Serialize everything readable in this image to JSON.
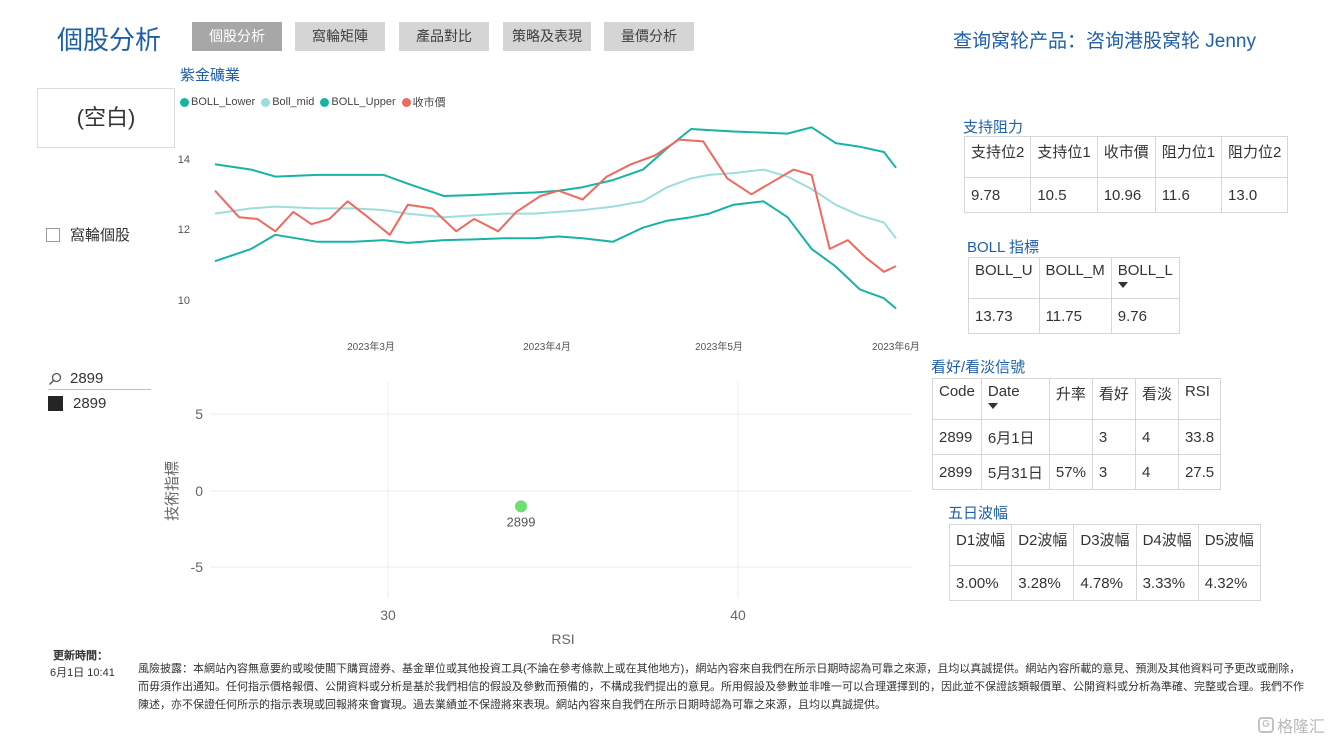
{
  "page_title": "個股分析",
  "tabs": [
    {
      "label": "個股分析",
      "active": true
    },
    {
      "label": "窩輪矩陣",
      "active": false
    },
    {
      "label": "產品對比",
      "active": false
    },
    {
      "label": "策略及表現",
      "active": false
    },
    {
      "label": "量價分析",
      "active": false
    }
  ],
  "query_title": "查询窝轮产品：咨询港股窝轮 Jenny",
  "blank_card": "(空白)",
  "warrant_checkbox_label": "窩輪個股",
  "search": {
    "value": "2899",
    "icon": "search-icon"
  },
  "slicer_item": "2899",
  "boll_chart": {
    "title": "紫金礦業",
    "legend": [
      {
        "name": "BOLL_Lower",
        "color": "#17b3a3"
      },
      {
        "name": "Boll_mid",
        "color": "#9cdedd"
      },
      {
        "name": "BOLL_Upper",
        "color": "#17b3a3"
      },
      {
        "name": "收市價",
        "color": "#ee6a5f"
      }
    ],
    "y_ticks": [
      "14",
      "12",
      "10"
    ],
    "x_ticks": [
      "2023年3月",
      "2023年4月",
      "2023年5月",
      "2023年6月"
    ]
  },
  "scatter_chart": {
    "ylabel": "技術指標",
    "xlabel": "RSI",
    "y_ticks": [
      "5",
      "0",
      "-5"
    ],
    "x_ticks": [
      "30",
      "40"
    ],
    "point_label": "2899",
    "point_color": "#6ee06e"
  },
  "chart_data": [
    {
      "type": "line",
      "title": "紫金礦業",
      "x_range": [
        "2023-02-08",
        "2023-06-01"
      ],
      "ylim": [
        9.5,
        15
      ],
      "x_ticks": [
        "2023年3月",
        "2023年4月",
        "2023年5月",
        "2023年6月"
      ],
      "series": [
        {
          "name": "BOLL_Upper",
          "color": "#17b3a3",
          "x": [
            "2023-02-08",
            "2023-02-14",
            "2023-02-18",
            "2023-02-25",
            "2023-03-03",
            "2023-03-08",
            "2023-03-12",
            "2023-03-18",
            "2023-03-23",
            "2023-03-28",
            "2023-04-02",
            "2023-04-06",
            "2023-04-10",
            "2023-04-15",
            "2023-04-20",
            "2023-04-24",
            "2023-04-28",
            "2023-05-01",
            "2023-05-05",
            "2023-05-10",
            "2023-05-14",
            "2023-05-18",
            "2023-05-22",
            "2023-05-26",
            "2023-05-30",
            "2023-06-01"
          ],
          "values": [
            13.85,
            13.7,
            13.5,
            13.55,
            13.55,
            13.55,
            13.3,
            12.95,
            12.98,
            13.02,
            13.05,
            13.1,
            13.2,
            13.4,
            13.7,
            14.3,
            14.85,
            14.82,
            14.78,
            14.75,
            14.72,
            14.9,
            14.45,
            14.35,
            14.2,
            13.75
          ]
        },
        {
          "name": "Boll_mid",
          "color": "#9cdedd",
          "x": [
            "2023-02-08",
            "2023-02-14",
            "2023-02-18",
            "2023-02-25",
            "2023-03-03",
            "2023-03-08",
            "2023-03-12",
            "2023-03-18",
            "2023-03-23",
            "2023-03-28",
            "2023-04-02",
            "2023-04-06",
            "2023-04-10",
            "2023-04-15",
            "2023-04-20",
            "2023-04-24",
            "2023-04-28",
            "2023-05-01",
            "2023-05-05",
            "2023-05-10",
            "2023-05-14",
            "2023-05-18",
            "2023-05-22",
            "2023-05-26",
            "2023-05-30",
            "2023-06-01"
          ],
          "values": [
            12.45,
            12.6,
            12.65,
            12.6,
            12.6,
            12.55,
            12.45,
            12.35,
            12.4,
            12.45,
            12.45,
            12.5,
            12.55,
            12.65,
            12.8,
            13.2,
            13.45,
            13.55,
            13.6,
            13.7,
            13.5,
            13.15,
            12.7,
            12.4,
            12.2,
            11.75
          ]
        },
        {
          "name": "BOLL_Lower",
          "color": "#17b3a3",
          "x": [
            "2023-02-08",
            "2023-02-14",
            "2023-02-18",
            "2023-02-25",
            "2023-03-03",
            "2023-03-08",
            "2023-03-12",
            "2023-03-18",
            "2023-03-23",
            "2023-03-28",
            "2023-04-02",
            "2023-04-06",
            "2023-04-10",
            "2023-04-15",
            "2023-04-20",
            "2023-04-24",
            "2023-04-28",
            "2023-05-01",
            "2023-05-05",
            "2023-05-10",
            "2023-05-14",
            "2023-05-18",
            "2023-05-22",
            "2023-05-26",
            "2023-05-30",
            "2023-06-01"
          ],
          "values": [
            11.1,
            11.45,
            11.85,
            11.65,
            11.65,
            11.7,
            11.62,
            11.7,
            11.72,
            11.75,
            11.75,
            11.8,
            11.75,
            11.65,
            12.05,
            12.25,
            12.35,
            12.45,
            12.7,
            12.8,
            12.35,
            11.45,
            10.95,
            10.3,
            10.05,
            9.76
          ]
        },
        {
          "name": "收市價",
          "color": "#ee6a5f",
          "x": [
            "2023-02-08",
            "2023-02-12",
            "2023-02-15",
            "2023-02-18",
            "2023-02-21",
            "2023-02-24",
            "2023-02-27",
            "2023-03-02",
            "2023-03-05",
            "2023-03-09",
            "2023-03-12",
            "2023-03-16",
            "2023-03-20",
            "2023-03-23",
            "2023-03-27",
            "2023-03-30",
            "2023-04-03",
            "2023-04-06",
            "2023-04-10",
            "2023-04-14",
            "2023-04-18",
            "2023-04-22",
            "2023-04-26",
            "2023-04-30",
            "2023-05-04",
            "2023-05-08",
            "2023-05-11",
            "2023-05-15",
            "2023-05-18",
            "2023-05-21",
            "2023-05-24",
            "2023-05-27",
            "2023-05-30",
            "2023-06-01"
          ],
          "values": [
            13.1,
            12.35,
            12.3,
            11.95,
            12.5,
            12.15,
            12.3,
            12.8,
            12.4,
            11.85,
            12.7,
            12.6,
            11.95,
            12.3,
            11.95,
            12.5,
            12.95,
            13.1,
            12.85,
            13.5,
            13.85,
            14.1,
            14.55,
            14.5,
            13.45,
            13.0,
            13.3,
            13.7,
            13.55,
            11.45,
            11.7,
            11.2,
            10.8,
            10.96
          ]
        }
      ]
    },
    {
      "type": "scatter",
      "xlabel": "RSI",
      "ylabel": "技術指標",
      "xlim": [
        25.5,
        45
      ],
      "ylim": [
        -7.5,
        7.5
      ],
      "x_ticks": [
        30,
        40
      ],
      "y_ticks": [
        5,
        0,
        -5
      ],
      "points": [
        {
          "label": "2899",
          "x": 33.8,
          "y": -1
        }
      ]
    }
  ],
  "support_resistance": {
    "title": "支持阻力",
    "headers": [
      "支持位2",
      "支持位1",
      "收市價",
      "阻力位1",
      "阻力位2"
    ],
    "rows": [
      [
        "9.78",
        "10.5",
        "10.96",
        "11.6",
        "13.0"
      ]
    ]
  },
  "boll_indicator": {
    "title": "BOLL 指標",
    "headers": [
      "BOLL_U",
      "BOLL_M",
      "BOLL_L"
    ],
    "rows": [
      [
        "13.73",
        "11.75",
        "9.76"
      ]
    ]
  },
  "signals": {
    "title": "看好/看淡信號",
    "headers": [
      "Code",
      "Date",
      "升率",
      "看好",
      "看淡",
      "RSI"
    ],
    "rows": [
      [
        "2899",
        "6月1日",
        "",
        "3",
        "4",
        "33.8"
      ],
      [
        "2899",
        "5月31日",
        "57%",
        "3",
        "4",
        "27.5"
      ]
    ]
  },
  "five_day": {
    "title": "五日波幅",
    "headers": [
      "D1波幅",
      "D2波幅",
      "D3波幅",
      "D4波幅",
      "D5波幅"
    ],
    "rows": [
      [
        "3.00%",
        "3.28%",
        "4.78%",
        "3.33%",
        "4.32%"
      ]
    ]
  },
  "footer": {
    "update_label": "更新時間：",
    "update_time": "6月1日 10:41",
    "disclaimer": "風險披露：本網站內容無意要約或唆使閣下購買證券、基金單位或其他投資工具(不論在參考條款上或在其他地方)，網站內容來自我們在所示日期時認為可靠之來源，且均以真誠提供。網站內容所載的意見、預測及其他資料可予更改或刪除，而毋須作出通知。任何指示價格報價、公開資料或分析是基於我們相信的假設及參數而預備的，不構成我們提出的意見。所用假設及參數並非唯一可以合理選擇到的，因此並不保證該類報價單、公開資料或分析為準確、完整或合理。我們不作陳述，亦不保證任何所示的指示表現或回報將來會實現。過去業績並不保證將來表現。網站內容來自我們在所示日期時認為可靠之來源，且均以真誠提供。"
  },
  "watermark": "格隆汇"
}
